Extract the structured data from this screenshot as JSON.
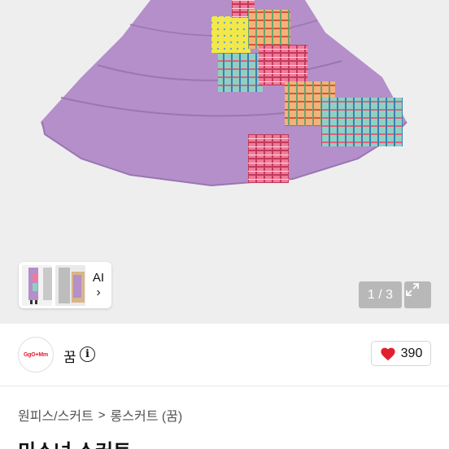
{
  "gallery": {
    "pager_text": "1 / 3",
    "ai_label": "AI",
    "ai_chevron": "›",
    "expand_icon": "expand-icon"
  },
  "seller": {
    "avatar_text": "GgO+Mm",
    "name": "꿈",
    "info_icon": "i",
    "like_count": "390",
    "heart_color": "#e0202f"
  },
  "breadcrumb": {
    "level1": "원피스/스커트",
    "separator": ">",
    "level2": "롱스커트 (꿈)"
  },
  "product": {
    "title": "미소녀 스커트"
  }
}
